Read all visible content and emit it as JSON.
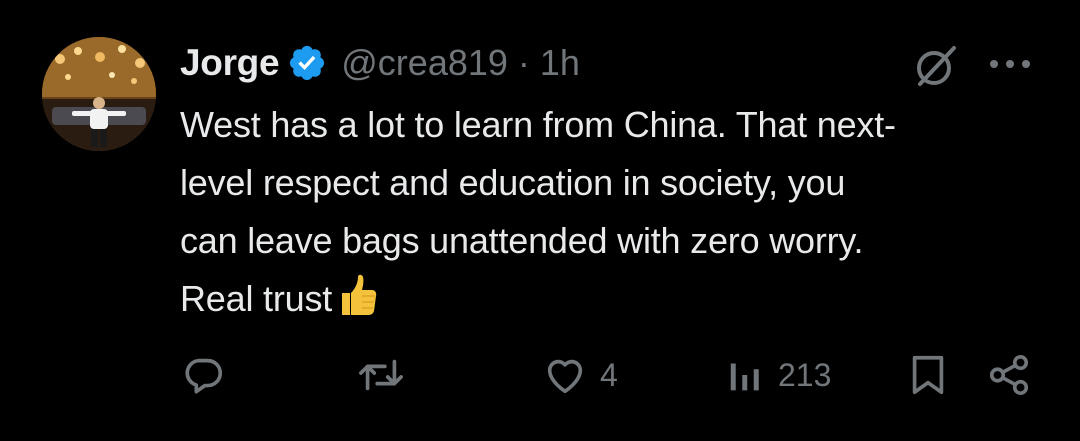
{
  "tweet": {
    "author_name": "Jorge",
    "handle": "@crea819",
    "separator": "·",
    "time": "1h",
    "text_lines": [
      "West has a lot to learn from China. That next-",
      "level respect and education in society, you",
      "can leave bags unattended with zero worry.",
      "Real trust"
    ],
    "emoji": "thumbs-up"
  },
  "actions": {
    "reply_count": "",
    "repost_count": "",
    "like_count": "4",
    "views_count": "213"
  },
  "icons": {
    "verified": "verified-badge-icon",
    "grok": "grok-icon",
    "more": "more-icon",
    "reply": "reply-icon",
    "repost": "repost-icon",
    "like": "heart-icon",
    "views": "views-icon",
    "bookmark": "bookmark-icon",
    "share": "share-icon"
  },
  "colors": {
    "background": "#000000",
    "text": "#e7e9ea",
    "secondary": "#71767b",
    "verified": "#1d9bf0"
  }
}
